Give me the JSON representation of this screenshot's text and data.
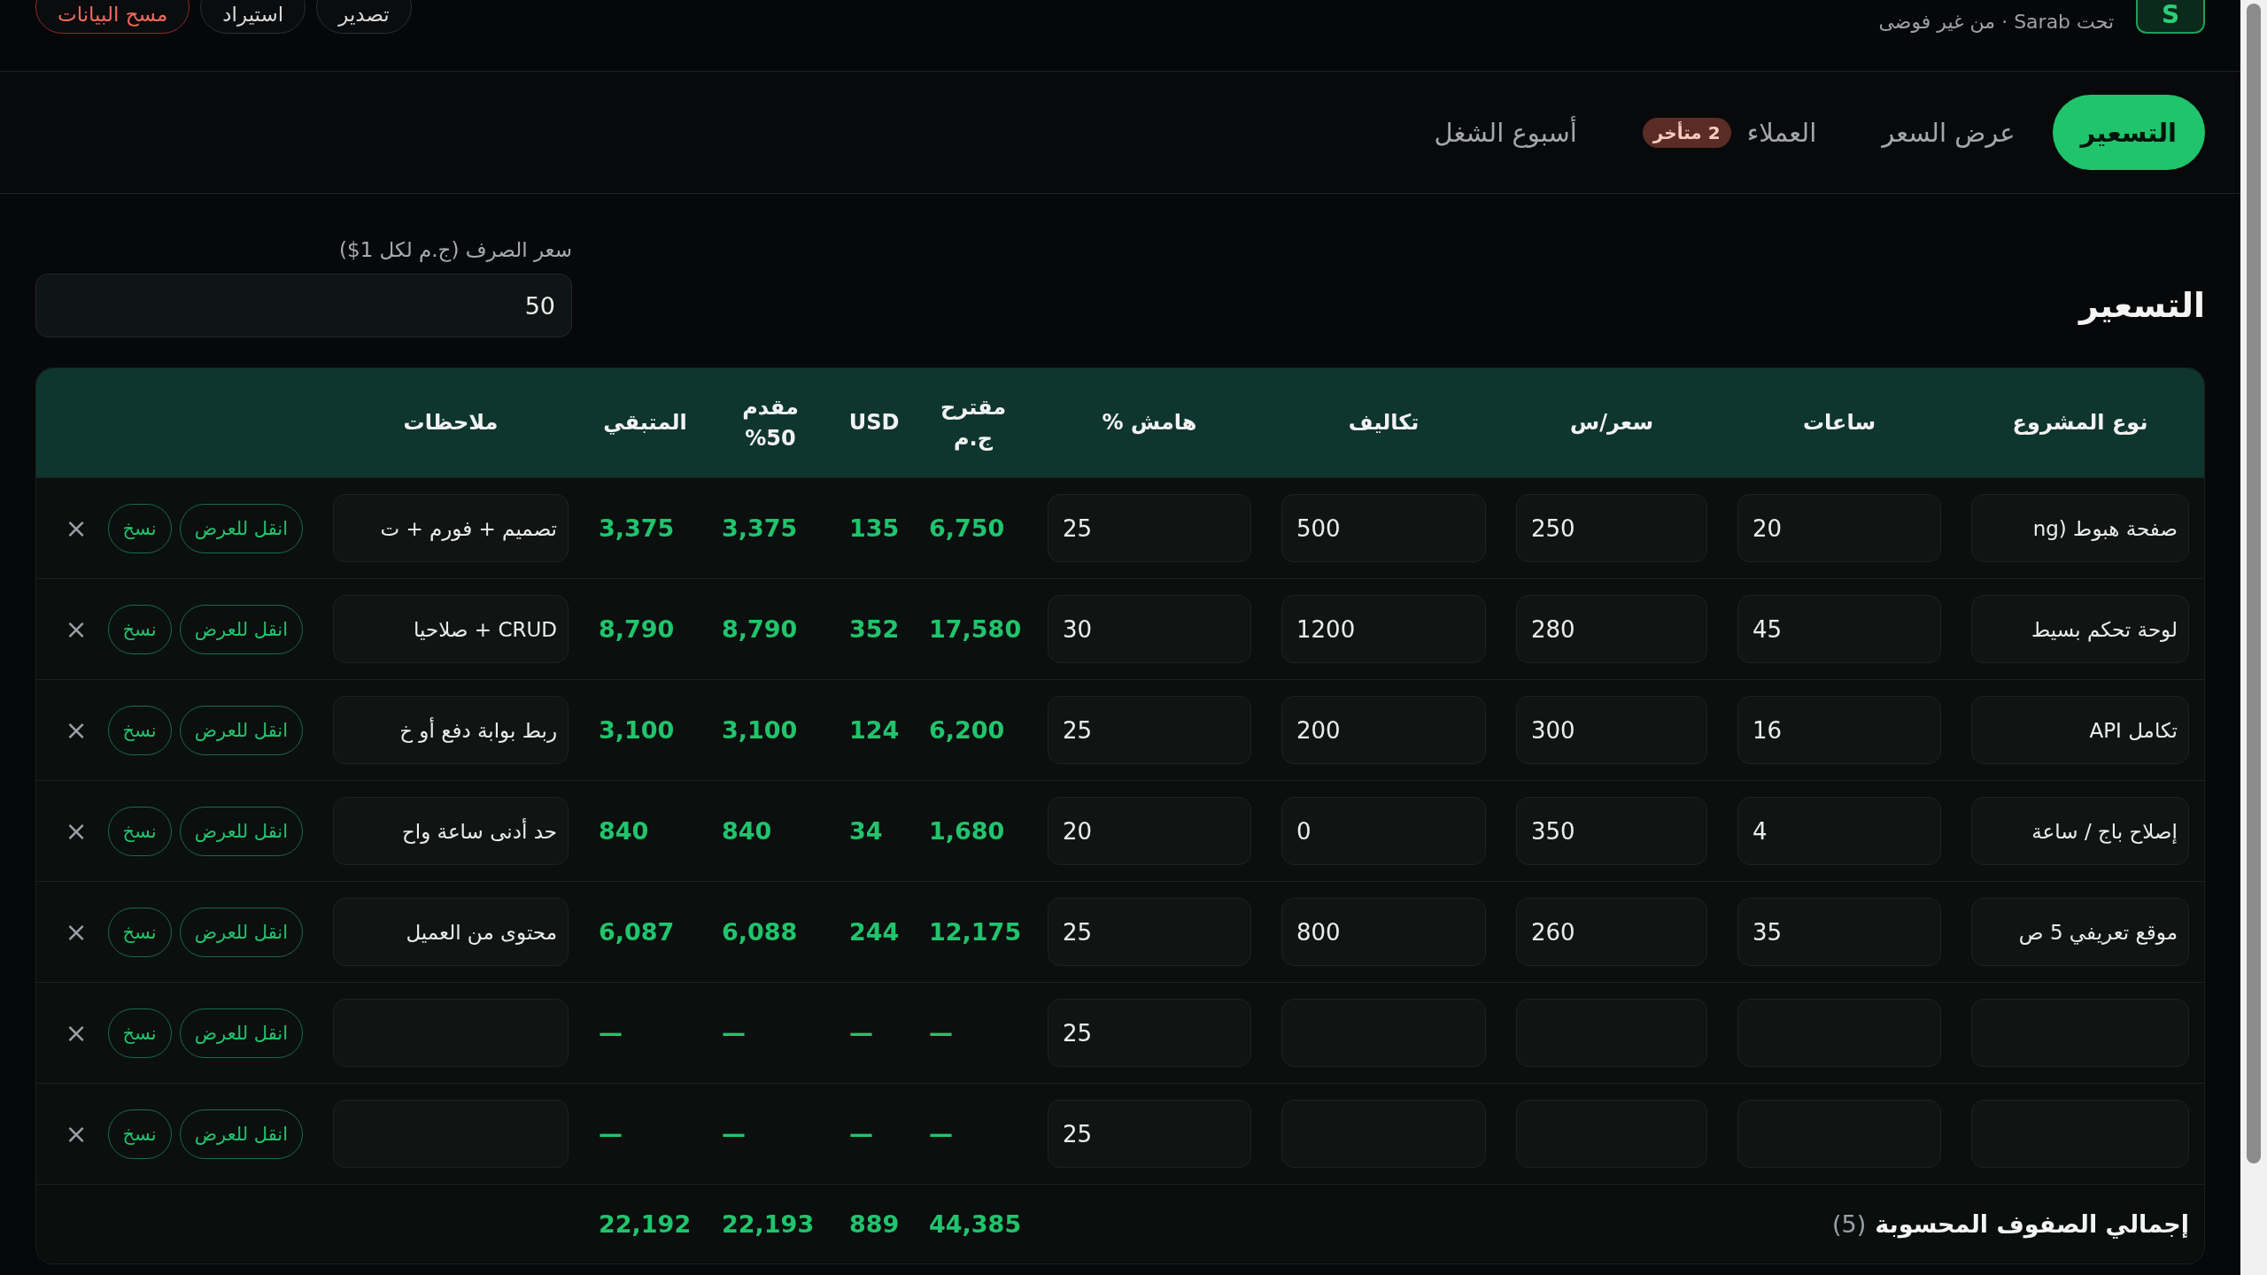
{
  "topbar": {
    "brand": {
      "logo": "S",
      "subtitle": "تحت Sarab · من غير فوضى"
    },
    "actions": [
      {
        "label": "تصدير",
        "kind": "outline"
      },
      {
        "label": "استيراد",
        "kind": "outline"
      },
      {
        "label": "مسح البيانات",
        "kind": "danger"
      }
    ]
  },
  "tabs": [
    {
      "label": "التسعير",
      "selected": true
    },
    {
      "label": "عرض السعر",
      "selected": false
    },
    {
      "label": "العملاء",
      "selected": false,
      "badge": "2 متأخر"
    },
    {
      "label": "أسبوع الشغل",
      "selected": false
    }
  ],
  "section": {
    "title": "التسعير",
    "rate": {
      "label": "سعر الصرف (ج.م لكل 1$)",
      "value": "50"
    }
  },
  "table": {
    "columns": [
      {
        "label": "نوع المشروع",
        "kind": "text"
      },
      {
        "label": "ساعات",
        "kind": "number"
      },
      {
        "label": "سعر/س",
        "kind": "number"
      },
      {
        "label": "تكاليف",
        "kind": "number"
      },
      {
        "label": "هامش %",
        "kind": "number"
      },
      {
        "label": "مقترح ج.م",
        "kind": "value"
      },
      {
        "label": "USD",
        "kind": "value"
      },
      {
        "label": "مقدم 50%",
        "kind": "value"
      },
      {
        "label": "المتبقي",
        "kind": "value"
      },
      {
        "label": "ملاحظات",
        "kind": "text"
      }
    ],
    "rows": [
      {
        "cells": [
          "صفحة هبوط (ng",
          "20",
          "250",
          "500",
          "25",
          "6,750",
          "135",
          "3,375",
          "3,375",
          "تصميم + فورم + ت"
        ],
        "actions": [
          {
            "label": "انقل للعرض",
            "kind": "move"
          },
          {
            "label": "نسخ",
            "kind": "copy"
          },
          {
            "label": "×",
            "kind": "remove"
          }
        ]
      },
      {
        "cells": [
          "لوحة تحكم بسيط",
          "45",
          "280",
          "1200",
          "30",
          "17,580",
          "352",
          "8,790",
          "8,790",
          "CRUD + صلاحيا"
        ],
        "actions": [
          {
            "label": "انقل للعرض",
            "kind": "move"
          },
          {
            "label": "نسخ",
            "kind": "copy"
          },
          {
            "label": "×",
            "kind": "remove"
          }
        ]
      },
      {
        "cells": [
          "تكامل API",
          "16",
          "300",
          "200",
          "25",
          "6,200",
          "124",
          "3,100",
          "3,100",
          "ربط بوابة دفع أو خ"
        ],
        "actions": [
          {
            "label": "انقل للعرض",
            "kind": "move"
          },
          {
            "label": "نسخ",
            "kind": "copy"
          },
          {
            "label": "×",
            "kind": "remove"
          }
        ]
      },
      {
        "cells": [
          "إصلاح باج / ساعة",
          "4",
          "350",
          "0",
          "20",
          "1,680",
          "34",
          "840",
          "840",
          "حد أدنى ساعة واح"
        ],
        "actions": [
          {
            "label": "انقل للعرض",
            "kind": "move"
          },
          {
            "label": "نسخ",
            "kind": "copy"
          },
          {
            "label": "×",
            "kind": "remove"
          }
        ]
      },
      {
        "cells": [
          "موقع تعريفي 5 ص",
          "35",
          "260",
          "800",
          "25",
          "12,175",
          "244",
          "6,088",
          "6,087",
          "محتوى من العميل"
        ],
        "actions": [
          {
            "label": "انقل للعرض",
            "kind": "move"
          },
          {
            "label": "نسخ",
            "kind": "copy"
          },
          {
            "label": "×",
            "kind": "remove"
          }
        ]
      },
      {
        "cells": [
          null,
          null,
          null,
          null,
          "25",
          "—",
          "—",
          "—",
          "—",
          null
        ],
        "actions": [
          {
            "label": "انقل للعرض",
            "kind": "move"
          },
          {
            "label": "نسخ",
            "kind": "copy"
          },
          {
            "label": "×",
            "kind": "remove"
          }
        ]
      },
      {
        "cells": [
          null,
          null,
          null,
          null,
          "25",
          "—",
          "—",
          "—",
          "—",
          null
        ],
        "actions": [
          {
            "label": "انقل للعرض",
            "kind": "move"
          },
          {
            "label": "نسخ",
            "kind": "copy"
          },
          {
            "label": "×",
            "kind": "remove"
          }
        ]
      }
    ],
    "totals": {
      "label": "إجمالي الصفوف المحسوبة",
      "count": "(5)",
      "values": [
        "44,385",
        "889",
        "22,193",
        "22,192"
      ]
    }
  }
}
